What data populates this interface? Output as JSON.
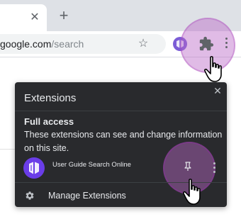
{
  "browser": {
    "tab": {
      "close_glyph": "✕"
    },
    "new_tab_glyph": "+",
    "omnibox": {
      "url_host": "google.com",
      "url_path": "/search",
      "bookmark_glyph": "☆"
    },
    "icons": {
      "bookmark": "star-icon",
      "extension": "user-guide-extension-icon",
      "extensions_menu": "puzzle-icon",
      "menu": "kebab-menu-icon"
    }
  },
  "popup": {
    "title": "Extensions",
    "close_glyph": "✕",
    "section_heading": "Full access",
    "section_description": "These extensions can see and change information on this site.",
    "extensions": [
      {
        "name": "User Guide Search Online",
        "icon": "user-guide-extension-icon",
        "pin_icon": "pin-icon",
        "more_icon": "kebab-menu-icon"
      }
    ],
    "manage_label": "Manage Extensions",
    "manage_icon": "gear-icon"
  },
  "colors": {
    "popup_bg": "#292a2d",
    "highlight": "#ba68c8",
    "extension_icon": "#6a3de8",
    "toolbar_icon": "#5f6368"
  }
}
